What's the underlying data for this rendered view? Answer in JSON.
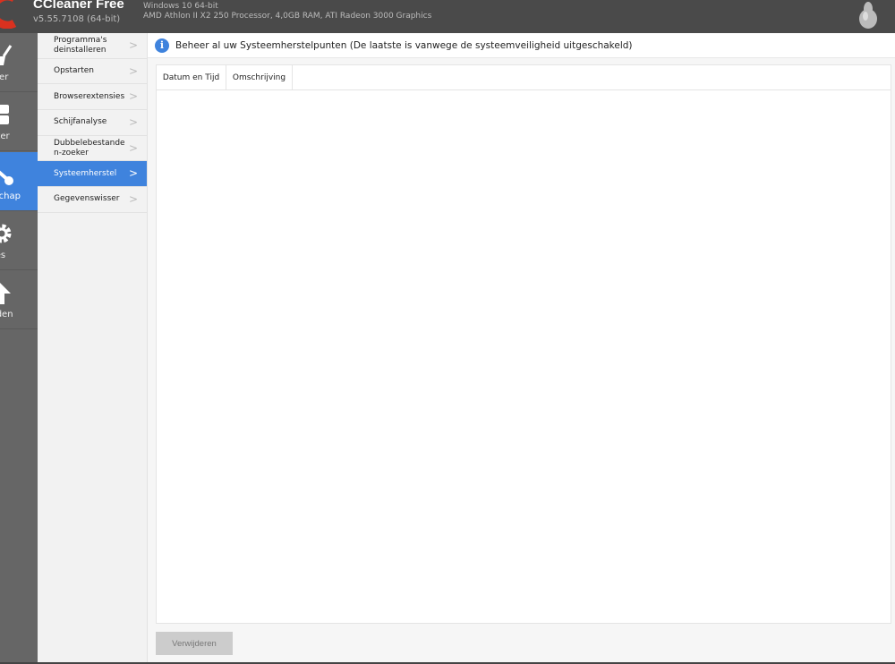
{
  "header": {
    "title": "CCleaner Free",
    "version": "v5.55.7108 (64-bit)",
    "os": "Windows 10 64-bit",
    "hardware": "AMD Athlon II X2 250 Processor, 4,0GB RAM, ATI Radeon 3000 Graphics"
  },
  "nav": [
    {
      "label": "Cleaner",
      "icon": "broom-icon"
    },
    {
      "label": "Register",
      "icon": "registry-icon"
    },
    {
      "label": "Gereedschap",
      "icon": "wrench-icon",
      "active": true
    },
    {
      "label": "Opties",
      "icon": "gear-icon"
    },
    {
      "label": "Upgraden",
      "icon": "upgrade-arrow-icon"
    }
  ],
  "submenu": [
    "Programma's deinstalleren",
    "Opstarten",
    "Browserextensies",
    "Schijfanalyse",
    "Dubbelebestanden-zoeker",
    "Systeemherstel",
    "Gegevenswisser"
  ],
  "active_submenu": "Systeemherstel",
  "info": {
    "text": "Beheer al uw Systeemherstelpunten (De laatste is vanwege de systeemveiligheid uitgeschakeld)"
  },
  "table": {
    "columns": [
      "Datum en Tijd",
      "Omschrijving"
    ],
    "rows": []
  },
  "buttons": {
    "delete": "Verwijderen"
  },
  "colors": {
    "accent": "#3f83dd",
    "header": "#4a4a4a",
    "nav": "#666666"
  }
}
